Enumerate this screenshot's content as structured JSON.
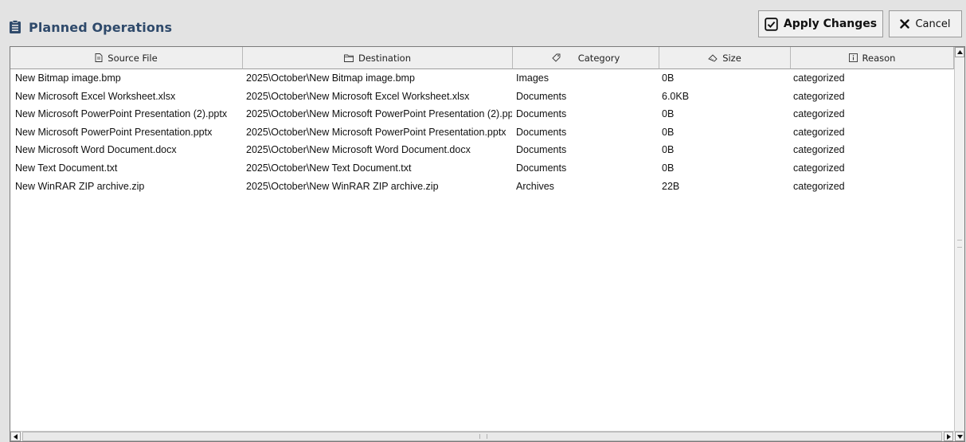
{
  "header": {
    "title": "Planned Operations",
    "apply_label": "Apply Changes",
    "cancel_label": "Cancel"
  },
  "table": {
    "columns": [
      {
        "label": "Source File",
        "icon": "document-icon"
      },
      {
        "label": "Destination",
        "icon": "folder-icon"
      },
      {
        "label": "Category",
        "icon": "tag-icon"
      },
      {
        "label": "Size",
        "icon": "ruler-icon"
      },
      {
        "label": "Reason",
        "icon": "info-icon"
      }
    ],
    "rows": [
      {
        "source": "New Bitmap image.bmp",
        "destination": "2025\\October\\New Bitmap image.bmp",
        "category": "Images",
        "size": "0B",
        "reason": "categorized"
      },
      {
        "source": "New Microsoft Excel Worksheet.xlsx",
        "destination": "2025\\October\\New Microsoft Excel Worksheet.xlsx",
        "category": "Documents",
        "size": "6.0KB",
        "reason": "categorized"
      },
      {
        "source": "New Microsoft PowerPoint Presentation (2).pptx",
        "destination": "2025\\October\\New Microsoft PowerPoint Presentation (2).pp",
        "category": "Documents",
        "size": "0B",
        "reason": "categorized"
      },
      {
        "source": "New Microsoft PowerPoint Presentation.pptx",
        "destination": "2025\\October\\New Microsoft PowerPoint Presentation.pptx",
        "category": "Documents",
        "size": "0B",
        "reason": "categorized"
      },
      {
        "source": "New Microsoft Word Document.docx",
        "destination": "2025\\October\\New Microsoft Word Document.docx",
        "category": "Documents",
        "size": "0B",
        "reason": "categorized"
      },
      {
        "source": "New Text Document.txt",
        "destination": "2025\\October\\New Text Document.txt",
        "category": "Documents",
        "size": "0B",
        "reason": "categorized"
      },
      {
        "source": "New WinRAR ZIP archive.zip",
        "destination": "2025\\October\\New WinRAR ZIP archive.zip",
        "category": "Archives",
        "size": "22B",
        "reason": "categorized"
      }
    ]
  },
  "colors": {
    "title": "#2f4a6b",
    "background": "#e3e3e3",
    "table_bg": "#ffffff",
    "header_bg": "#efefef"
  }
}
